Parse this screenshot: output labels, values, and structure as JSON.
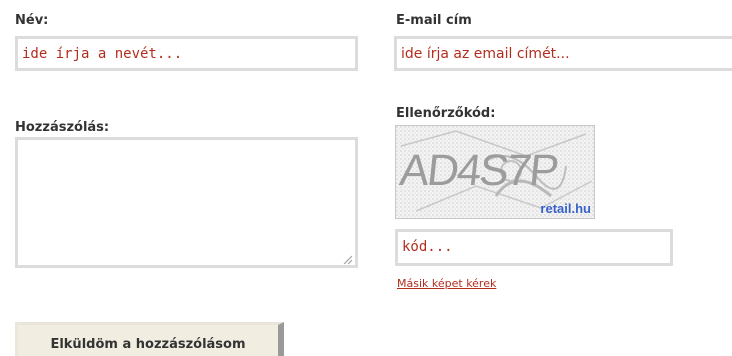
{
  "form": {
    "name": {
      "label": "Név:",
      "placeholder": "ide írja a nevét..."
    },
    "email": {
      "label": "E-mail cím",
      "placeholder": "ide írja az email címét..."
    },
    "comment": {
      "label": "Hozzászólás:",
      "value": ""
    },
    "captcha": {
      "label": "Ellenőrzőkód:",
      "image_text": "AD4S7P",
      "image_watermark": "retail.hu",
      "input_placeholder": "kód...",
      "refresh_link": "Másik képet kérek"
    },
    "submit_label": "Elküldöm a hozzászólásom"
  },
  "colors": {
    "placeholder_text": "#b32d1e",
    "link": "#b32d1e",
    "field_border": "#dcdcdc",
    "submit_bg": "#f1ede0",
    "captcha_watermark": "#3a63c9"
  },
  "icons": {
    "resize_grip": "resize-grip-icon"
  }
}
